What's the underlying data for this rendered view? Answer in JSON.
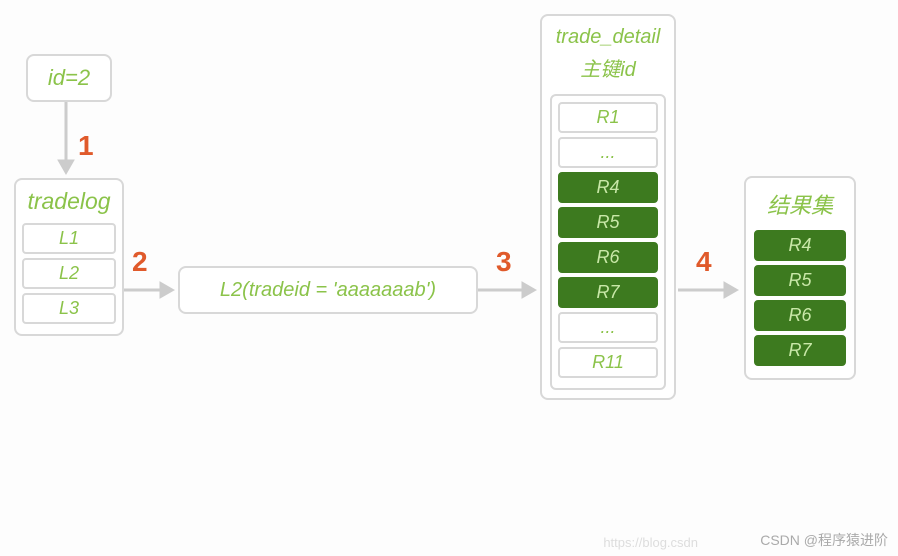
{
  "id_box": {
    "text": "id=2"
  },
  "steps": {
    "s1": "1",
    "s2": "2",
    "s3": "3",
    "s4": "4"
  },
  "tradelog": {
    "title": "tradelog",
    "rows": [
      "L1",
      "L2",
      "L3"
    ]
  },
  "mid_box": {
    "text": "L2(tradeid = 'aaaaaaab')"
  },
  "trade_detail": {
    "title_line1": "trade_detail",
    "title_line2": "主键id",
    "rows_top": [
      "R1",
      "..."
    ],
    "rows_hl": [
      "R4",
      "R5",
      "R6",
      "R7"
    ],
    "rows_bottom": [
      "...",
      "R11"
    ]
  },
  "result": {
    "title": "结果集",
    "rows": [
      "R4",
      "R5",
      "R6",
      "R7"
    ]
  },
  "watermark": "CSDN @程序猿进阶",
  "watermark_faint": "https://blog.csdn"
}
